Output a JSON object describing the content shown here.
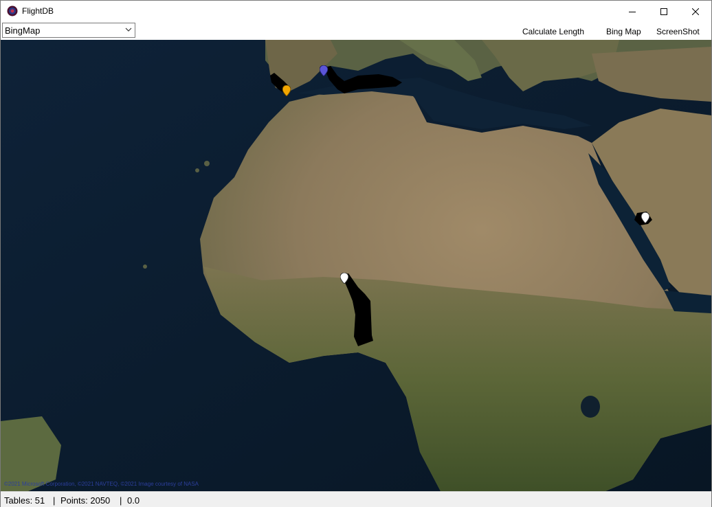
{
  "window": {
    "title": "FlightDB",
    "icon": "flightdb-app-icon"
  },
  "toolbar": {
    "map_select_value": "BingMap",
    "calculate_length_label": "Calculate Length",
    "bing_map_label": "Bing Map",
    "screenshot_label": "ScreenShot"
  },
  "map": {
    "copyright": "©2021 Microsoft Corporation, ©2021 NAVTEQ, ©2021 Image courtesy of NASA",
    "pins": [
      {
        "id": "blue",
        "color": "#5b55d8"
      },
      {
        "id": "orange",
        "color": "#f2a600"
      },
      {
        "id": "white-center",
        "color": "#ffffff"
      },
      {
        "id": "white-east",
        "color": "#ffffff"
      }
    ]
  },
  "status": {
    "tables": "Tables: 51",
    "sep1": "|",
    "points": "Points: 2050",
    "sep2": "|",
    "value": "0.0"
  }
}
